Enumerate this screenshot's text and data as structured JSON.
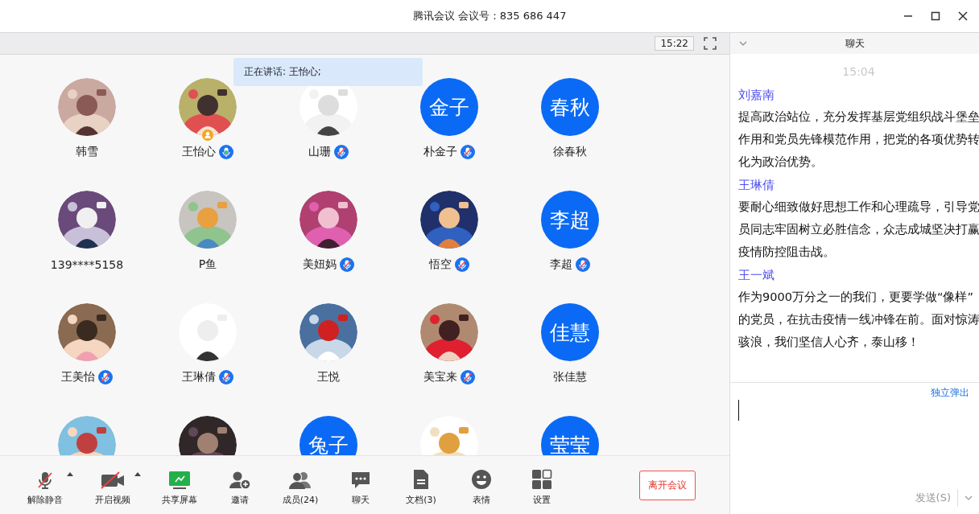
{
  "window": {
    "title": "腾讯会议 会议号：835 686 447"
  },
  "meeting_bar": {
    "timer": "15:22"
  },
  "speaking_banner": "正在讲话: 王怡心;",
  "participants": [
    {
      "name": "韩雪",
      "avatar": {
        "kind": "picture"
      }
    },
    {
      "name": "王怡心",
      "avatar": {
        "kind": "picture"
      },
      "host": true,
      "mic_muted": false
    },
    {
      "name": "山珊",
      "avatar": {
        "kind": "picture"
      },
      "mic_muted": true
    },
    {
      "name": "朴金子",
      "avatar": {
        "kind": "initials",
        "text": "金子"
      },
      "mic_muted": true
    },
    {
      "name": "徐春秋",
      "avatar": {
        "kind": "initials",
        "text": "春秋"
      }
    },
    {
      "name": "139****5158",
      "avatar": {
        "kind": "picture"
      }
    },
    {
      "name": "P鱼",
      "avatar": {
        "kind": "picture"
      }
    },
    {
      "name": "美妞妈",
      "avatar": {
        "kind": "picture"
      },
      "mic_muted": true
    },
    {
      "name": "悟空",
      "avatar": {
        "kind": "picture"
      },
      "mic_muted": true
    },
    {
      "name": "李超",
      "avatar": {
        "kind": "initials",
        "text": "李超"
      },
      "mic_muted": true
    },
    {
      "name": "王美怡",
      "avatar": {
        "kind": "picture"
      },
      "mic_muted": true
    },
    {
      "name": "王琳倩",
      "avatar": {
        "kind": "picture"
      },
      "mic_muted": true
    },
    {
      "name": "王悦",
      "avatar": {
        "kind": "picture"
      }
    },
    {
      "name": "美宝来",
      "avatar": {
        "kind": "picture"
      },
      "mic_muted": true
    },
    {
      "name": "张佳慧",
      "avatar": {
        "kind": "initials",
        "text": "佳慧"
      }
    },
    {
      "avatar": {
        "kind": "picture"
      }
    },
    {
      "avatar": {
        "kind": "picture"
      }
    },
    {
      "avatar": {
        "kind": "initials",
        "text": "兔子"
      }
    },
    {
      "avatar": {
        "kind": "picture"
      }
    },
    {
      "avatar": {
        "kind": "initials",
        "text": "莹莹"
      }
    }
  ],
  "toolbar": [
    {
      "label": "解除静音",
      "kind": "mic",
      "has_menu": true
    },
    {
      "label": "开启视频",
      "kind": "camera",
      "has_menu": true
    },
    {
      "label": "共享屏幕",
      "kind": "share"
    },
    {
      "label": "邀请",
      "kind": "invite"
    },
    {
      "label": "成员(24)",
      "kind": "members"
    },
    {
      "label": "聊天",
      "kind": "chat"
    },
    {
      "label": "文档(3)",
      "kind": "docs"
    },
    {
      "label": "表情",
      "kind": "emoji"
    },
    {
      "label": "设置",
      "kind": "settings"
    }
  ],
  "leave_button": "离开会议",
  "chat": {
    "title": "聊天",
    "time": "15:04",
    "messages": [
      {
        "sender": "刘嘉南",
        "text": "提高政治站位，充分发挥基层党组织战斗堡垒作用和党员先锋模范作用，把党的各项优势转化为政治优势。"
      },
      {
        "sender": "王琳倩",
        "text": "要耐心细致做好思想工作和心理疏导，引导党员同志牢固树立必胜信念，众志成城坚决打赢疫情防控阻击战。"
      },
      {
        "sender": "王一斌",
        "text": "作为9000万分之一的我们，更要学做“像样”的党员，在抗击疫情一线冲锋在前。面对惊涛骇浪，我们坚信人心齐，泰山移！"
      }
    ],
    "popout_link": "独立弹出",
    "send_button": "发送(S)"
  }
}
